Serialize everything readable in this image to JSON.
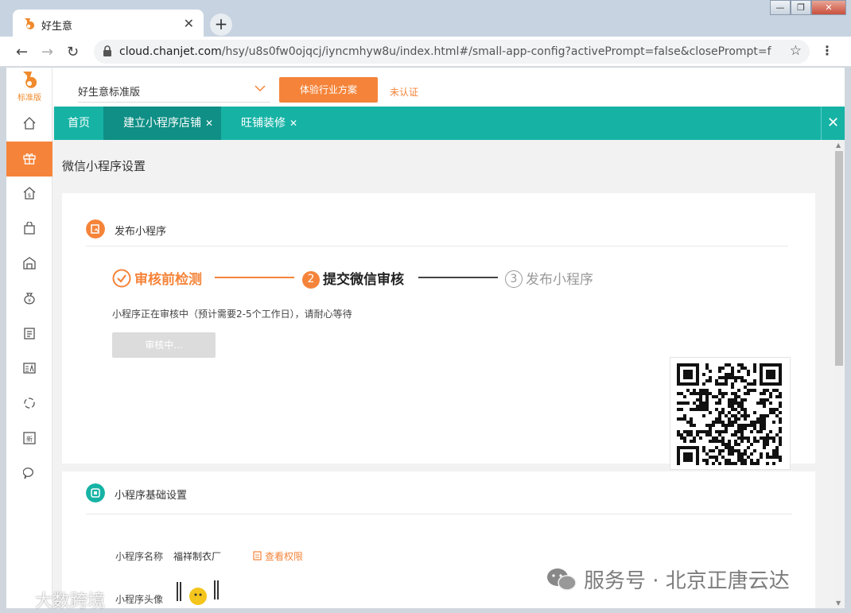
{
  "browser": {
    "tab_title": "好生意",
    "new_tab": "+",
    "url_domain": "cloud.chanjet.com",
    "url_rest": "/hsy/u8s0fw0ojqcj/iyncmhyw8u/index.html#/small-app-config?activePrompt=false&closePrompt=false..."
  },
  "app": {
    "logo_text": "标准版",
    "store_name": "好生意标准版",
    "trial_button": "体验行业方案",
    "unverified": "未认证",
    "accent": "#f5843a",
    "teal": "#16b3a5",
    "tabs": [
      {
        "label": "首页"
      },
      {
        "label": "建立小程序店铺"
      },
      {
        "label": "旺铺装修"
      }
    ],
    "sidebar_icons": [
      "home-icon",
      "gift-icon",
      "store-icon",
      "shopping-bag-icon",
      "warehouse-icon",
      "money-bag-icon",
      "clipboard-icon",
      "report-icon",
      "cycle-icon",
      "new-icon",
      "chat-icon"
    ]
  },
  "page": {
    "title": "微信小程序设置",
    "publish": {
      "section_title": "发布小程序",
      "steps": [
        {
          "label": "审核前检测",
          "state": "done"
        },
        {
          "num": "2",
          "label": "提交微信审核",
          "state": "active"
        },
        {
          "num": "3",
          "label": "发布小程序",
          "state": "pending"
        }
      ],
      "status_text": "小程序正在审核中（预计需要2-5个工作日），请耐心等待",
      "review_button": "审核中..."
    },
    "basic": {
      "section_title": "小程序基础设置",
      "name_label": "小程序名称",
      "name_value": "福祥制衣厂",
      "permission_link": "查看权限",
      "avatar_label": "小程序头像"
    }
  },
  "watermarks": {
    "right": "服务号 · 北京正唐云达",
    "left": "大数跨境"
  }
}
